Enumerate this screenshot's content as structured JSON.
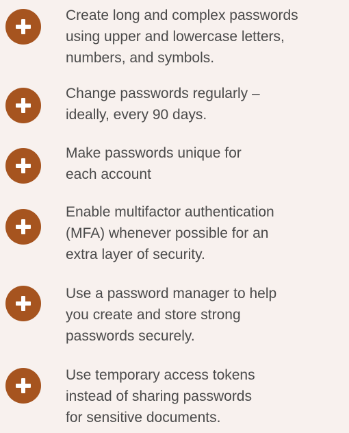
{
  "tips": [
    {
      "icon": "plus-icon",
      "text": "Create long and complex passwords\nusing upper and lowercase letters,\nnumbers, and symbols."
    },
    {
      "icon": "plus-icon",
      "text": "Change passwords regularly –\nideally, every 90 days."
    },
    {
      "icon": "plus-icon",
      "text": "Make passwords unique for\neach account"
    },
    {
      "icon": "plus-icon",
      "text": "Enable multifactor authentication\n(MFA) whenever possible for an\nextra layer of security."
    },
    {
      "icon": "plus-icon",
      "text": "Use a password manager to help\nyou create and store strong\npasswords securely."
    },
    {
      "icon": "plus-icon",
      "text": "Use temporary access tokens\ninstead of sharing passwords\nfor sensitive documents."
    }
  ],
  "colors": {
    "background": "#f8f1ee",
    "accent": "#a6541f",
    "text": "#4a4a4a"
  }
}
